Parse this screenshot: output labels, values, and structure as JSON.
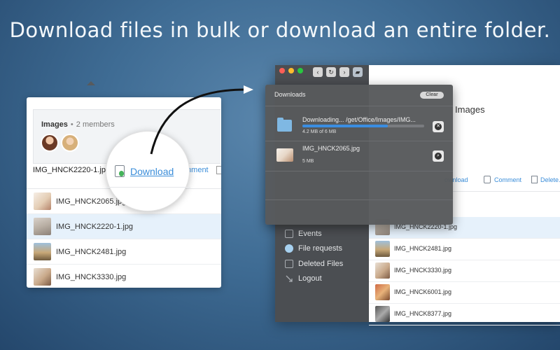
{
  "headline": "Download files in bulk or download an entire folder.",
  "left_card": {
    "folder_name": "Images",
    "separator": "•",
    "members": "2 members",
    "selected_file": "IMG_HNCK2220-1.jpg",
    "download_label": "Download",
    "comment_label": "mment",
    "files": [
      "IMG_HNCK2065.jpg",
      "IMG_HNCK2220-1.jpg",
      "IMG_HNCK2481.jpg",
      "IMG_HNCK3330.jpg"
    ],
    "selected_index": 1
  },
  "app": {
    "sidebar": {
      "items": [
        {
          "label": "Events",
          "icon": "calendar-icon"
        },
        {
          "label": "File requests",
          "icon": "file-request-icon"
        },
        {
          "label": "Deleted Files",
          "icon": "trash-icon"
        },
        {
          "label": "Logout",
          "icon": "logout-icon"
        }
      ]
    },
    "main": {
      "title": "Images",
      "actions": {
        "download": "ownload",
        "comment": "Comment",
        "delete": "Delete..."
      },
      "files": [
        "IMG_HNCK2220-1.jpg",
        "IMG_HNCK2481.jpg",
        "IMG_HNCK3330.jpg",
        "IMG_HNCK6001.jpg",
        "IMG_HNCK8377.jpg"
      ],
      "selected_index": 0
    },
    "downloads": {
      "title": "Downloads",
      "clear_label": "Clear",
      "items": [
        {
          "text": "Downloading... /get/Office/Images/IMG...",
          "size": "4.2 MB of 6 MB",
          "progress": 0.7,
          "icon": "folder-icon",
          "action": "cancel-icon"
        },
        {
          "text": "IMG_HNCK2065.jpg",
          "size": "5 MB",
          "icon": "image-thumbnail",
          "action": "reveal-icon"
        }
      ]
    }
  },
  "colors": {
    "accent": "#3a8dd9",
    "progress": "#3a8de1",
    "sidebar": "#4b4e52"
  }
}
